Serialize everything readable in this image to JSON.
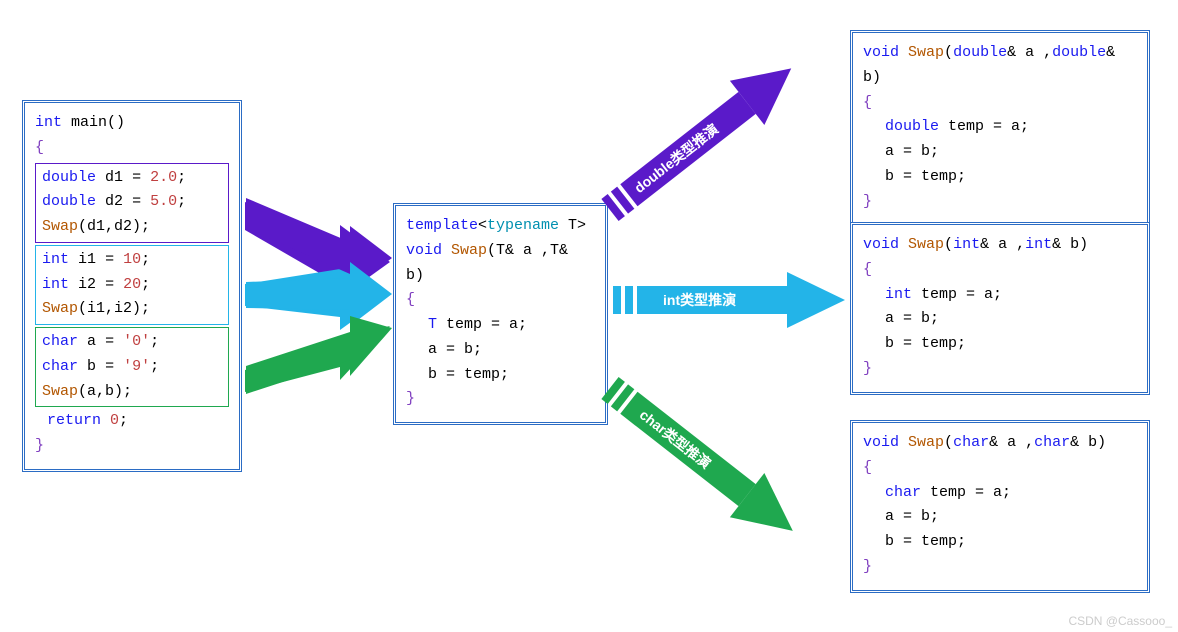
{
  "main_box": {
    "line1": {
      "type": "int",
      "fn": "main",
      "suffix": "()"
    },
    "open": "{",
    "grp1": {
      "l1": {
        "type": "double",
        "var": "d1",
        "eq": "=",
        "val": "2.0",
        "end": ";"
      },
      "l2": {
        "type": "double",
        "var": "d2",
        "eq": "=",
        "val": "5.0",
        "end": ";"
      },
      "l3": {
        "fn": "Swap",
        "args": "(d1,d2)",
        "end": ";"
      }
    },
    "grp2": {
      "l1": {
        "type": "int",
        "var": "i1",
        "eq": "=",
        "val": "10",
        "end": ";"
      },
      "l2": {
        "type": "int",
        "var": "i2",
        "eq": "=",
        "val": "20",
        "end": ";"
      },
      "l3": {
        "fn": "Swap",
        "args": "(i1,i2)",
        "end": ";"
      }
    },
    "grp3": {
      "l1": {
        "type": "char",
        "var": "a",
        "eq": "=",
        "val": "'0'",
        "end": ";"
      },
      "l2": {
        "type": "char",
        "var": "b",
        "eq": "=",
        "val": "'9'",
        "end": ";"
      },
      "l3": {
        "fn": "Swap",
        "args": "(a,b)",
        "end": ";"
      }
    },
    "ret": {
      "kw": "return",
      "val": "0",
      "end": ";"
    },
    "close": "}"
  },
  "template_box": {
    "l1_a": "template",
    "l1_b": "<",
    "l1_c": "typename",
    "l1_d": " T>",
    "l2_a": "void",
    "l2_fn": "Swap",
    "l2_args": "(T& a ,T& b)",
    "open": "{",
    "l3_a": "T",
    "l3_b": " temp = a;",
    "l4": "a = b;",
    "l5": "b = temp;",
    "close": "}"
  },
  "double_box": {
    "l1_a": "void",
    "l1_fn": "Swap",
    "l1_b": "(",
    "l1_c": "double",
    "l1_d": "& a ,",
    "l1_e": "double",
    "l1_f": "& b)",
    "open": "{",
    "l2_a": "double",
    "l2_b": " temp = a;",
    "l3": "a = b;",
    "l4": "b = temp;",
    "close": "}"
  },
  "int_box": {
    "l1_a": "void",
    "l1_fn": "Swap",
    "l1_b": "(",
    "l1_c": "int",
    "l1_d": "& a ,",
    "l1_e": "int",
    "l1_f": "& b)",
    "open": "{",
    "l2_a": "int",
    "l2_b": " temp = a;",
    "l3": "a = b;",
    "l4": "b = temp;",
    "close": "}"
  },
  "char_box": {
    "l1_a": "void",
    "l1_fn": "Swap",
    "l1_b": "(",
    "l1_c": "char",
    "l1_d": "& a ,",
    "l1_e": "char",
    "l1_f": "& b)",
    "open": "{",
    "l2_a": "char",
    "l2_b": " temp = a;",
    "l3": "a = b;",
    "l4": "b = temp;",
    "close": "}"
  },
  "labels": {
    "double": "double类型推演",
    "int": "int类型推演",
    "char": "char类型推演"
  },
  "colors": {
    "purple": "#5a1ac9",
    "cyan": "#23b4e8",
    "green": "#1fa84f"
  },
  "watermark": "CSDN @Cassooo_"
}
